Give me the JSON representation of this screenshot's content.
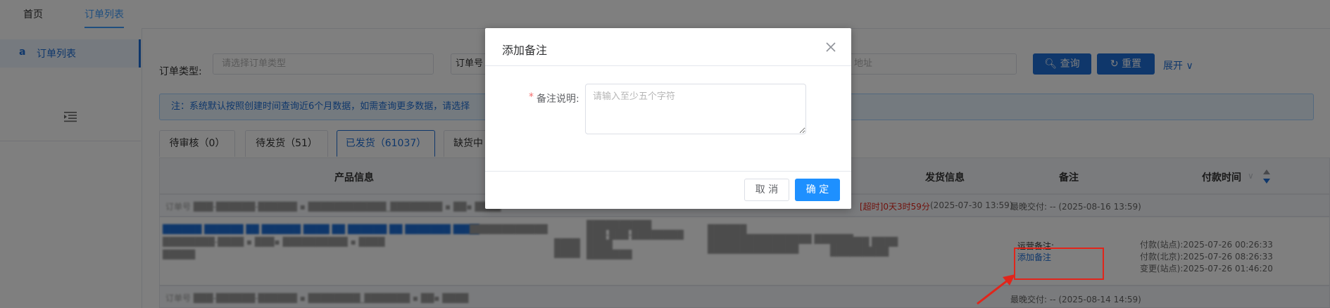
{
  "nav": {
    "home": "首页",
    "order_list": "订单列表"
  },
  "sidebar": {
    "items": [
      {
        "icon": "amazon-icon",
        "glyph": "a",
        "label": "订单列表"
      }
    ],
    "collapse_icon": "menu-fold-icon"
  },
  "filters": {
    "order_type_label": "订单类型:",
    "order_type_placeholder": "请选择订单类型",
    "order_no_label": "订单号",
    "address_placeholder": "地址",
    "query_button": "查询",
    "reset_button": "重置",
    "expand": "展开"
  },
  "notice": "注：系统默认按照创建时间查询近6个月数据，如需查询更多数据，请选择",
  "status_tabs": [
    {
      "label": "待审核（0）",
      "active": false
    },
    {
      "label": "待发货（51）",
      "active": false
    },
    {
      "label": "已发货（61037）",
      "active": true
    },
    {
      "label": "缺货中",
      "active": false
    }
  ],
  "table": {
    "headers": {
      "product": "产品信息",
      "ship": "发货信息",
      "remark": "备注",
      "pay_time": "付款时间"
    },
    "row1": {
      "timeout": "[超时]0天3时59分",
      "ship_date": "(2025-07-30 13:59)",
      "latest_delivery": "最晚交付: -- (2025-08-16 13:59)",
      "ops_remark_label": "运营备注:",
      "add_remark": "添加备注",
      "pay_site": "付款(站点):2025-07-26 00:26:33",
      "pay_bj": "付款(北京):2025-07-26 08:26:33",
      "change_site": "变更(站点):2025-07-26 01:46:20"
    },
    "row2": {
      "latest_delivery": "最晚交付: -- (2025-08-14 14:59)"
    }
  },
  "dialog": {
    "title": "添加备注",
    "required_mark": "*",
    "field_label": "备注说明:",
    "placeholder": "请输入至少五个字符",
    "cancel": "取 消",
    "confirm": "确 定"
  },
  "colors": {
    "primary": "#1e6fd6",
    "highlight": "#e1251b",
    "confirm": "#1e90ff"
  }
}
